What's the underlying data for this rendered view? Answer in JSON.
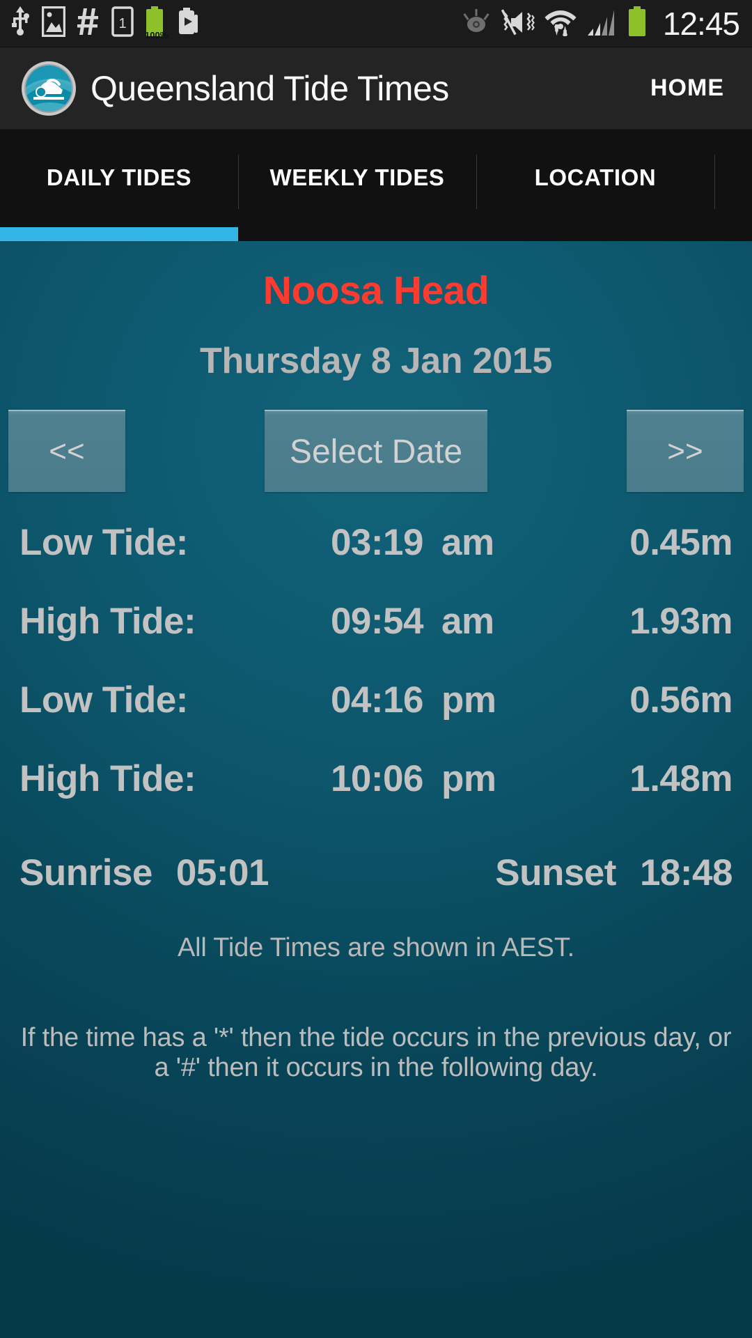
{
  "status_bar": {
    "time": "12:45",
    "battery_percent": "100%",
    "left_icons": [
      "usb-icon",
      "image-icon",
      "hash-icon",
      "sim-1-icon",
      "battery-charging-icon",
      "app-install-icon"
    ],
    "right_icons": [
      "eye-smart-stay-icon",
      "sound-mute-vibrate-icon",
      "wifi-data-transfer-icon",
      "cellular-signal-icon",
      "battery-icon"
    ]
  },
  "action_bar": {
    "logo_name": "queensland-tide-times-logo",
    "title": "Queensland Tide Times",
    "home_label": "HOME"
  },
  "tabs": {
    "items": [
      {
        "label": "DAILY TIDES",
        "selected": true
      },
      {
        "label": "WEEKLY TIDES",
        "selected": false
      },
      {
        "label": "LOCATION",
        "selected": false
      }
    ],
    "indicator_color": "#33b5e5"
  },
  "main": {
    "location_name": "Noosa Head",
    "location_color": "#ff3b30",
    "date": "Thursday 8 Jan 2015",
    "nav": {
      "prev_label": "<<",
      "select_date_label": "Select Date",
      "next_label": ">>"
    },
    "tides": [
      {
        "label": "Low Tide:",
        "time": "03:19",
        "meridiem": "am",
        "height": "0.45m"
      },
      {
        "label": "High Tide:",
        "time": "09:54",
        "meridiem": "am",
        "height": "1.93m"
      },
      {
        "label": "Low Tide:",
        "time": "04:16",
        "meridiem": "pm",
        "height": "0.56m"
      },
      {
        "label": "High Tide:",
        "time": "10:06",
        "meridiem": "pm",
        "height": "1.48m"
      }
    ],
    "sun": {
      "sunrise_label": "Sunrise",
      "sunrise_time": "05:01",
      "sunset_label": "Sunset",
      "sunset_time": "18:48"
    },
    "note_timezone": "All Tide Times are shown in AEST.",
    "note_legend": "If the time has a '*' then the tide occurs in the previous day, or a '#' then it occurs in the following day."
  }
}
